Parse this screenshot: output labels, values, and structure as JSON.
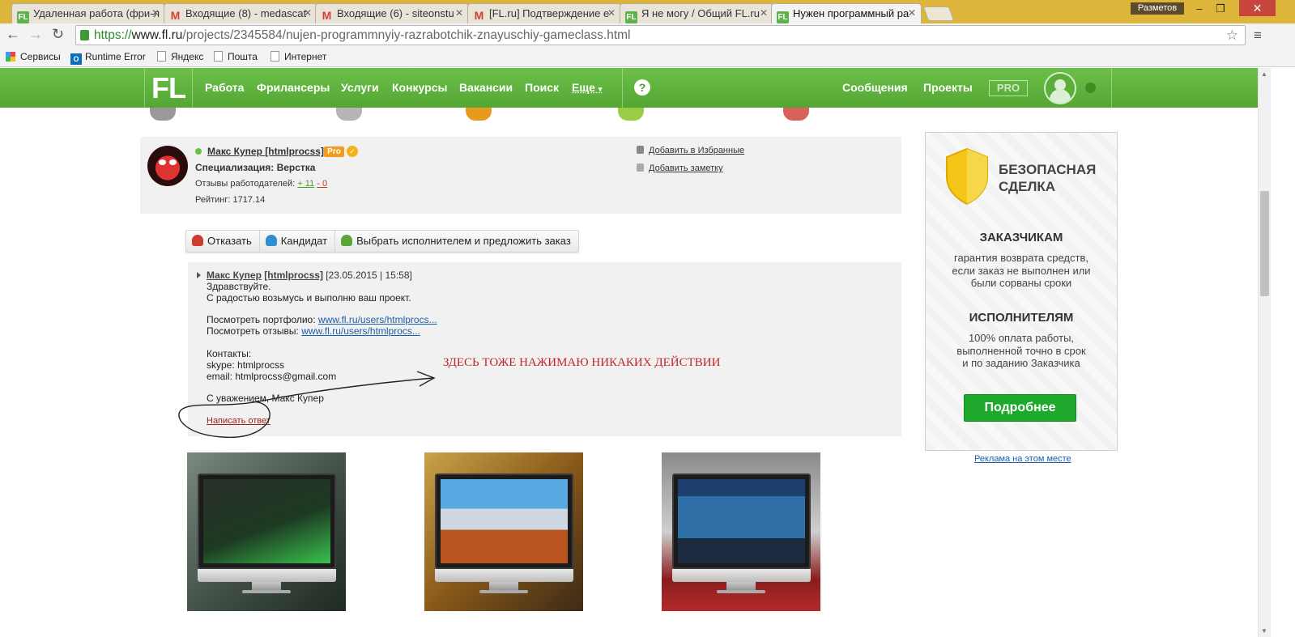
{
  "browser": {
    "tabs": [
      {
        "title": "Удаленная работа (фри-л",
        "favicon": "fl-icon"
      },
      {
        "title": "Входящие (8) - medascat",
        "favicon": "gmail-icon"
      },
      {
        "title": "Входящие (6) - siteonstu",
        "favicon": "gmail-icon"
      },
      {
        "title": "[FL.ru] Подтверждение е",
        "favicon": "gmail-icon"
      },
      {
        "title": "Я не могу / Общий FL.ru",
        "favicon": "fl-icon"
      },
      {
        "title": "Нужен программный ра",
        "favicon": "fl-icon",
        "active": true
      }
    ],
    "window_user": "Разметов",
    "url_scheme": "https://",
    "url_host": "www.fl.ru",
    "url_path": "/projects/2345584/nujen-programmnyiy-razrabotchik-znayuschiy-gameclass.html",
    "bookmarks": [
      "Сервисы",
      "Runtime Error",
      "Яндекс",
      "Пошта",
      "Интернет"
    ]
  },
  "site": {
    "logo": "FL",
    "nav": [
      "Работа",
      "Фрилансеры",
      "Услуги",
      "Конкурсы",
      "Вакансии",
      "Поиск"
    ],
    "more": "Еще",
    "help": "?",
    "messages": "Сообщения",
    "projects": "Проекты",
    "pro": "PRO"
  },
  "proposal": {
    "user_name": "Макс Купер",
    "user_login": "[htmlprocss]",
    "pro_badge": "Pro",
    "specialization": "Специализация: Верстка",
    "reviews_label": "Отзывы работодателей:",
    "reviews_pos": "+ 11",
    "reviews_neg": "- 0",
    "rating": "Рейтинг: 1717.14",
    "add_favorite": "Добавить в Избранные",
    "add_note": "Добавить заметку"
  },
  "actions": {
    "reject": "Отказать",
    "candidate": "Кандидат",
    "choose": "Выбрать исполнителем и предложить заказ"
  },
  "message": {
    "author": "Макс Купер",
    "login": "[htmlprocss]",
    "date": "[23.05.2015 | 15:58]",
    "line1": "Здравствуйте.",
    "line2": "С радостью возьмусь и выполню ваш проект.",
    "portfolio_label": "Посмотреть портфолио:",
    "portfolio_link": "www.fl.ru/users/htmlprocs...",
    "reviews_label": "Посмотреть отзывы:",
    "reviews_link": "www.fl.ru/users/htmlprocs...",
    "contacts": "Контакты:",
    "skype": "skype: htmlprocss",
    "email": "email: htmlprocss@gmail.com",
    "signature": "С уважением, Макс Купер",
    "reply": "Написать ответ"
  },
  "annotation": "ЗДЕСЬ ТОЖЕ НАЖИМАЮ НИКАКИХ ДЕЙСТВИИ",
  "banner": {
    "title_line1": "БЕЗОПАСНАЯ",
    "title_line2": "СДЕЛКА",
    "clients_h": "ЗАКАЗЧИКАМ",
    "clients_p1": "гарантия возврата средств,",
    "clients_p2": "если заказ не выполнен или",
    "clients_p3": "были сорваны сроки",
    "freelancers_h": "ИСПОЛНИТЕЛЯМ",
    "freelancers_p1": "100% оплата работы,",
    "freelancers_p2": "выполненной точно в срок",
    "freelancers_p3": "и по заданию Заказчика",
    "button": "Подробнее",
    "ad_link": "Реклама на этом месте"
  },
  "colors": {
    "brand_green": "#5bb33a",
    "button_green": "#1ea82c",
    "annotation_red": "#c0262d",
    "shield_yellow": "#f5c518"
  }
}
